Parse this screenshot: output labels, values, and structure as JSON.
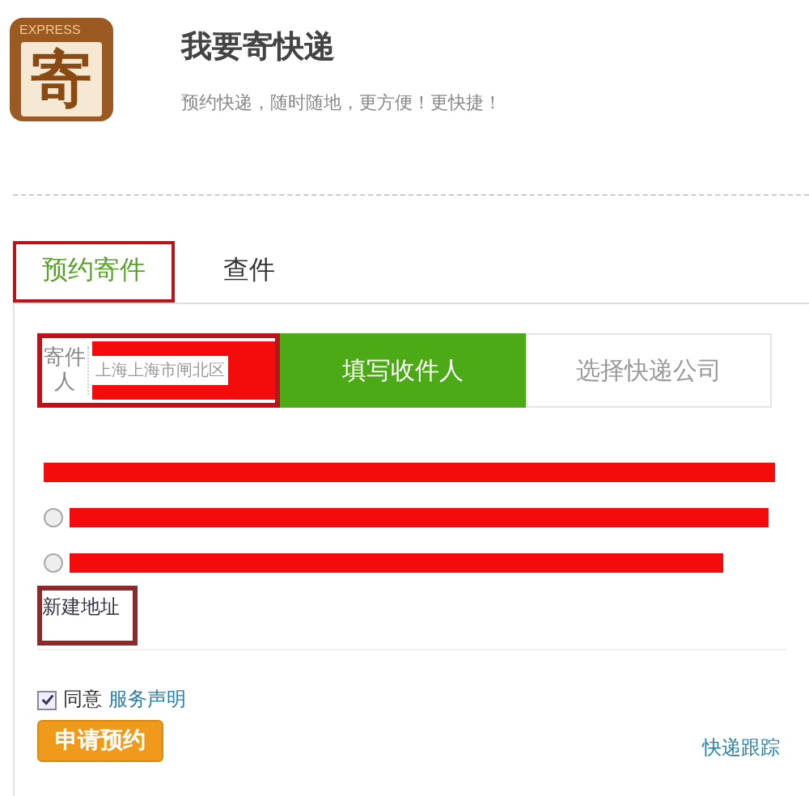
{
  "header": {
    "logo": {
      "caption": "EXPRESS",
      "glyph": "寄"
    },
    "title": "我要寄快递",
    "subtitle": "预约快递，随时随地，更方便！更快捷！"
  },
  "tabs": [
    {
      "label": "预约寄件",
      "selected": true,
      "highlighted": true
    },
    {
      "label": "查件",
      "selected": false,
      "highlighted": false
    }
  ],
  "sender": {
    "label": "寄件人",
    "address": "上海上海市闸北区",
    "highlighted": true
  },
  "steps": [
    {
      "label": "填写收件人",
      "selected": true
    },
    {
      "label": "选择快递公司",
      "selected": false
    }
  ],
  "addresses": [
    {
      "kind": "plain",
      "redacted": true
    },
    {
      "kind": "radio",
      "selected": false,
      "redacted": true
    },
    {
      "kind": "radio",
      "selected": false,
      "redacted": true
    }
  ],
  "new_address": {
    "label": "新建地址",
    "highlighted": true
  },
  "agreement": {
    "checked": true,
    "label": "同意",
    "link": "服务声明"
  },
  "submit": "申请预约",
  "tracking_link": "快递跟踪"
}
